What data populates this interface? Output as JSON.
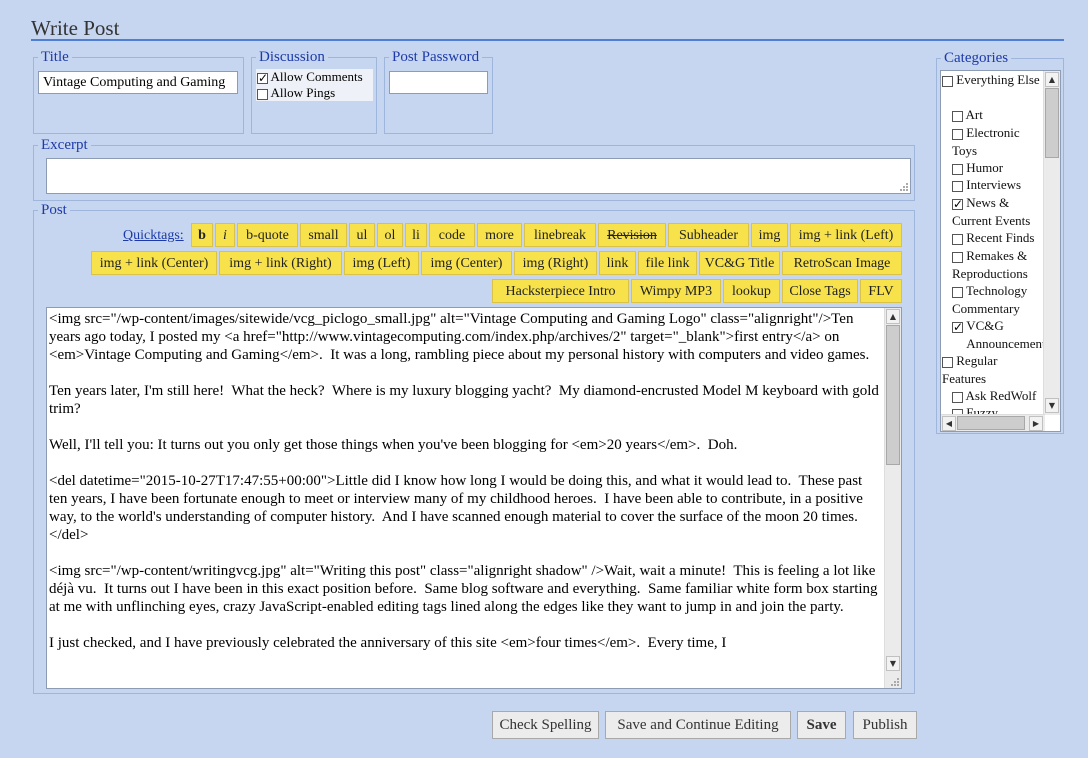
{
  "page": {
    "title": "Write Post"
  },
  "title_box": {
    "legend": "Title",
    "value": "Vintage Computing and Gaming"
  },
  "discussion": {
    "legend": "Discussion",
    "allow_comments": "Allow Comments",
    "allow_pings": "Allow Pings",
    "comments_checked": true,
    "pings_checked": false
  },
  "password": {
    "legend": "Post Password",
    "value": ""
  },
  "excerpt": {
    "legend": "Excerpt",
    "value": ""
  },
  "post": {
    "legend": "Post",
    "quicktags_label": "Quicktags:",
    "quicktags": [
      "b",
      "i",
      "b-quote",
      "small",
      "ul",
      "ol",
      "li",
      "code",
      "more",
      "linebreak",
      "Revision",
      "Subheader",
      "img",
      "img + link (Left)",
      "img + link (Center)",
      "img + link (Right)",
      "img (Left)",
      "img (Center)",
      "img (Right)",
      "link",
      "file link",
      "VC&G Title",
      "RetroScan Image",
      "Hacksterpiece Intro",
      "Wimpy MP3",
      "lookup",
      "Close Tags",
      "FLV"
    ],
    "content": "<img src=\"/wp-content/images/sitewide/vcg_piclogo_small.jpg\" alt=\"Vintage Computing and Gaming Logo\" class=\"alignright\"/>Ten years ago today, I posted my <a href=\"http://www.vintagecomputing.com/index.php/archives/2\" target=\"_blank\">first entry</a> on <em>Vintage Computing and Gaming</em>.  It was a long, rambling piece about my personal history with computers and video games.\n\nTen years later, I'm still here!  What the heck?  Where is my luxury blogging yacht?  My diamond-encrusted Model M keyboard with gold trim?\n\nWell, I'll tell you: It turns out you only get those things when you've been blogging for <em>20 years</em>.  Doh.\n\n<del datetime=\"2015-10-27T17:47:55+00:00\">Little did I know how long I would be doing this, and what it would lead to.  These past ten years, I have been fortunate enough to meet or interview many of my childhood heroes.  I have been able to contribute, in a positive way, to the world's understanding of computer history.  And I have scanned enough material to cover the surface of the moon 20 times.</del>\n\n<img src=\"/wp-content/writingvcg.jpg\" alt=\"Writing this post\" class=\"alignright shadow\" />Wait, wait a minute!  This is feeling a lot like déjà vu.  It turns out I have been in this exact position before.  Same blog software and everything.  Same familiar white form box starting at me with unflinching eyes, crazy JavaScript-enabled editing tags lined along the edges like they want to jump in and join the party.\n\nI just checked, and I have previously celebrated the anniversary of this site <em>four times</em>.  Every time, I"
  },
  "buttons": {
    "check_spelling": "Check Spelling",
    "save_continue": "Save and Continue Editing",
    "save": "Save",
    "publish": "Publish"
  },
  "categories": {
    "legend": "Categories",
    "items": [
      {
        "label": "Everything Else",
        "checked": false
      },
      {
        "label": "Art",
        "checked": false
      },
      {
        "label": "Electronic Toys",
        "checked": false
      },
      {
        "label": "Humor",
        "checked": false
      },
      {
        "label": "Interviews",
        "checked": false
      },
      {
        "label": "News & Current Events",
        "checked": true
      },
      {
        "label": "Recent Finds",
        "checked": false
      },
      {
        "label": "Remakes & Reproductions",
        "checked": false
      },
      {
        "label": "Technology Commentary",
        "checked": false
      },
      {
        "label": "VC&G Announcements",
        "checked": true
      },
      {
        "label": "Regular Features",
        "checked": false
      },
      {
        "label": "Ask RedWolf",
        "checked": false
      },
      {
        "label": "Fuzzy",
        "checked": false
      }
    ]
  },
  "colors": {
    "background": "#c7d6f0",
    "legend": "#1c3aa8",
    "quicktag": "#f7e24b",
    "rule": "#4f7fd0"
  }
}
